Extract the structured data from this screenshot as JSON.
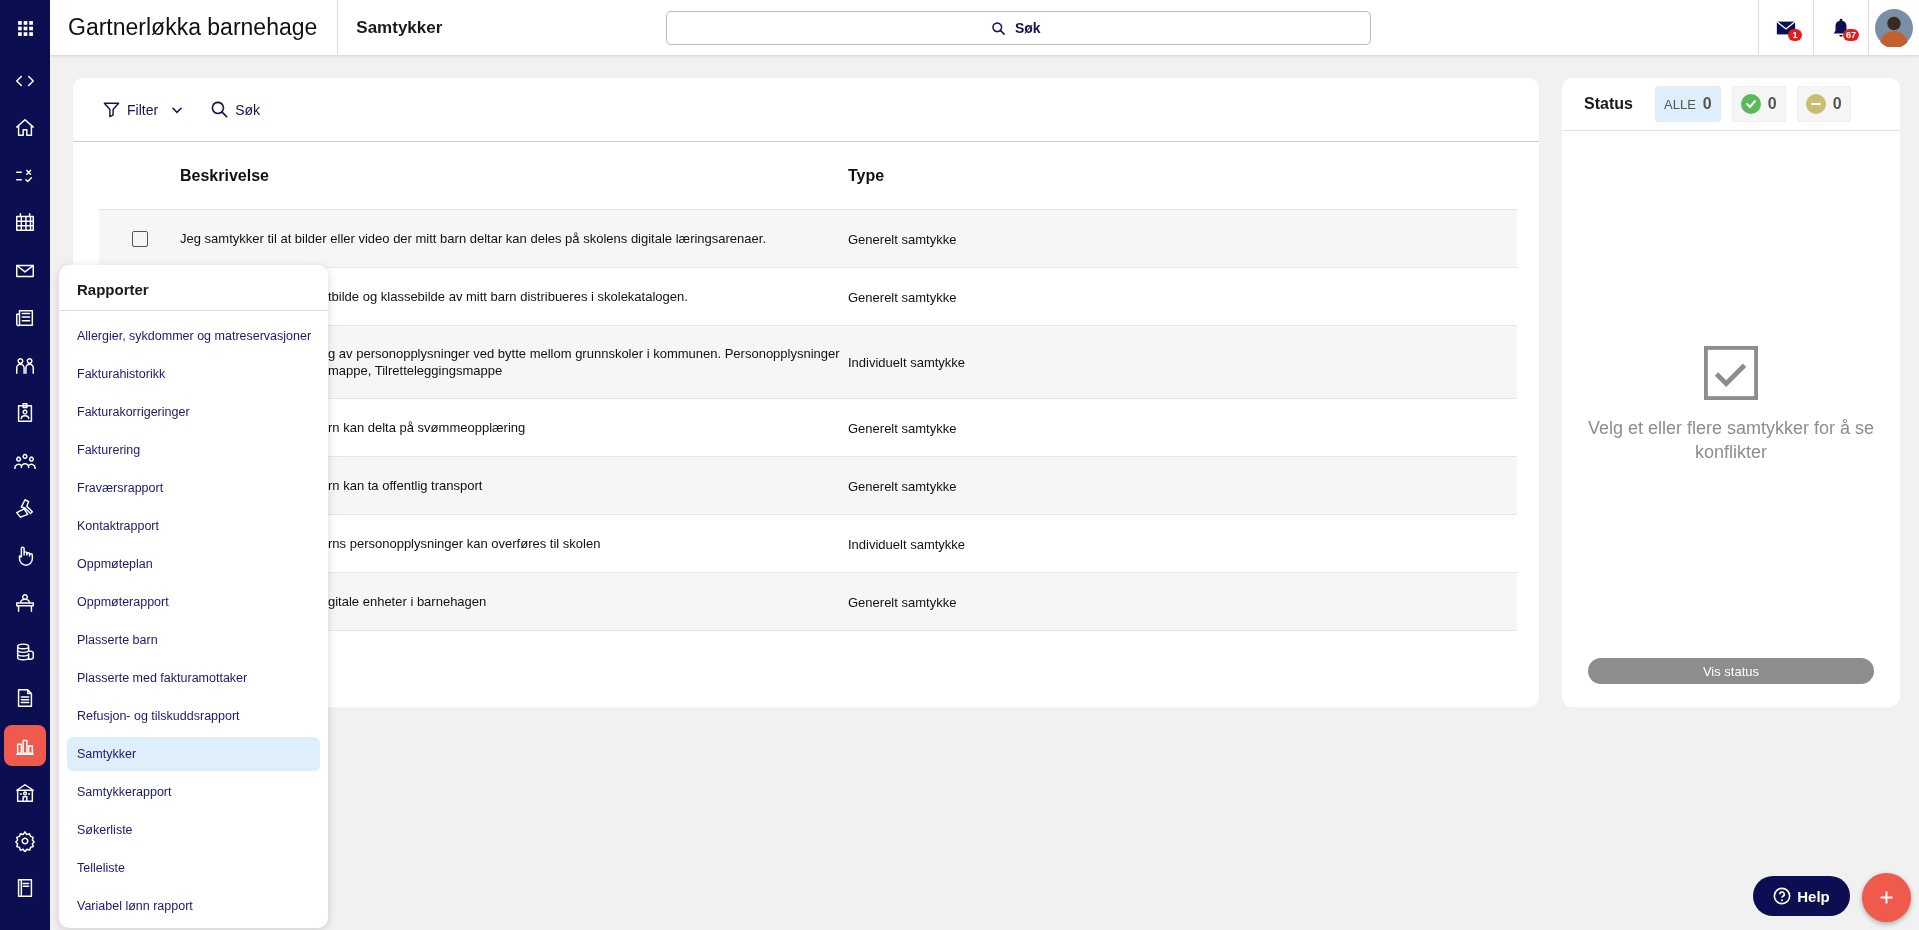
{
  "topbar": {
    "org_name": "Gartnerløkka barnehage",
    "page_title": "Samtykker",
    "search": {
      "placeholder": "Søk"
    },
    "mail_badge": "1",
    "notification_badge": "67"
  },
  "sidebar": {
    "items": [
      {
        "selected": false
      },
      {
        "selected": false
      },
      {
        "selected": false
      },
      {
        "selected": false
      },
      {
        "selected": false
      },
      {
        "selected": false
      },
      {
        "selected": false
      },
      {
        "selected": false
      },
      {
        "selected": false
      },
      {
        "selected": false
      },
      {
        "selected": false
      },
      {
        "selected": false
      },
      {
        "selected": false
      },
      {
        "selected": false
      },
      {
        "selected": true
      },
      {
        "selected": false
      },
      {
        "selected": false
      },
      {
        "selected": false
      }
    ]
  },
  "toolbar": {
    "filter_label": "Filter",
    "search_label": "Søk"
  },
  "table": {
    "columns": [
      "Beskrivelse",
      "Type"
    ],
    "rows": [
      {
        "checked": false,
        "description": [
          "Jeg samtykker til at bilder eller video der mitt barn deltar kan deles på skolens digitale læringsarenaer."
        ],
        "type": "Generelt samtykke"
      },
      {
        "description": [
          "tbilde og klassebilde av mitt barn distribueres i skolekatalogen."
        ],
        "type": "Generelt samtykke"
      },
      {
        "description": [
          "g av personopplysninger ved bytte mellom grunnskoler i kommunen. Personopplysninger",
          "mappe, Tilretteleggingsmappe"
        ],
        "type": "Individuelt samtykke"
      },
      {
        "description": [
          "rn kan delta på svømmeopplæring"
        ],
        "type": "Generelt samtykke"
      },
      {
        "description": [
          "rn kan ta offentlig transport"
        ],
        "type": "Generelt samtykke"
      },
      {
        "description": [
          "rns personopplysninger kan overføres til skolen"
        ],
        "type": "Individuelt samtykke"
      },
      {
        "description": [
          "gitale enheter i barnehagen"
        ],
        "type": "Generelt samtykke"
      }
    ]
  },
  "status": {
    "title": "Status",
    "filters": [
      {
        "kind": "all",
        "label": "ALLE",
        "count": "0",
        "selected": true
      },
      {
        "kind": "approved",
        "count": "0",
        "selected": false,
        "color": "#5cb85c"
      },
      {
        "kind": "declined",
        "count": "0",
        "selected": false,
        "color": "#c9bd72"
      }
    ],
    "empty_message": "Velg et eller flere samtykker for å se konflikter",
    "button": "Vis status"
  },
  "reports_menu": {
    "title": "Rapporter",
    "items": [
      {
        "label": "Allergier, sykdommer og matreservasjoner",
        "selected": false
      },
      {
        "label": "Fakturahistorikk",
        "selected": false
      },
      {
        "label": "Fakturakorrigeringer",
        "selected": false
      },
      {
        "label": "Fakturering",
        "selected": false
      },
      {
        "label": "Fraværsrapport",
        "selected": false
      },
      {
        "label": "Kontaktrapport",
        "selected": false
      },
      {
        "label": "Oppmøteplan",
        "selected": false
      },
      {
        "label": "Oppmøterapport",
        "selected": false
      },
      {
        "label": "Plasserte barn",
        "selected": false
      },
      {
        "label": "Plasserte med fakturamottaker",
        "selected": false
      },
      {
        "label": "Refusjon- og tilskuddsrapport",
        "selected": false
      },
      {
        "label": "Samtykker",
        "selected": true
      },
      {
        "label": "Samtykkerapport",
        "selected": false
      },
      {
        "label": "Søkerliste",
        "selected": false
      },
      {
        "label": "Telleliste",
        "selected": false
      },
      {
        "label": "Variabel lønn rapport",
        "selected": false
      }
    ]
  },
  "help_button": "Help"
}
